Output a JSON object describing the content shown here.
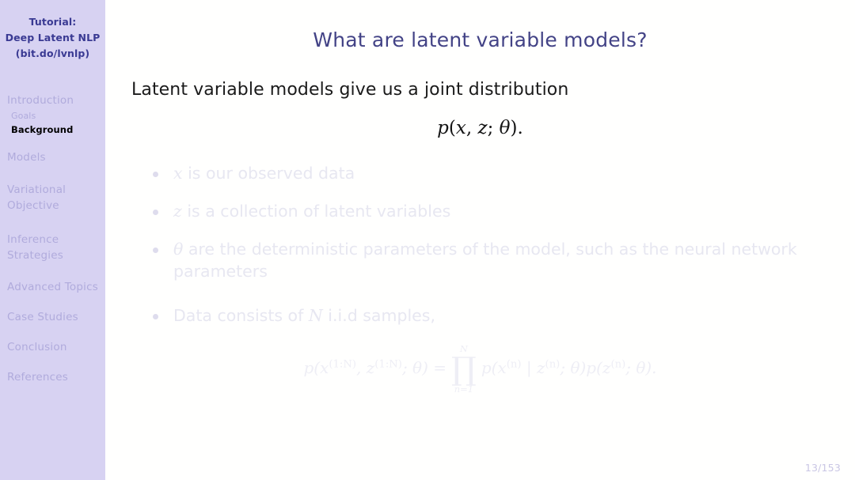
{
  "sidebar": {
    "title_lines": [
      "Tutorial:",
      "Deep Latent NLP",
      "(bit.do/lvnlp)"
    ],
    "nav": [
      {
        "label": "Introduction",
        "type": "section",
        "active": false
      },
      {
        "label": "Goals",
        "type": "subsection",
        "active": false
      },
      {
        "label": "Background",
        "type": "subsection",
        "active": true
      },
      {
        "label": "Models",
        "type": "section",
        "active": false
      },
      {
        "label": "Variational",
        "label2": "Objective",
        "type": "section",
        "active": false
      },
      {
        "label": "Inference",
        "label2": "Strategies",
        "type": "section",
        "active": false
      },
      {
        "label": "Advanced Topics",
        "type": "section",
        "active": false
      },
      {
        "label": "Case Studies",
        "type": "section",
        "active": false
      },
      {
        "label": "Conclusion",
        "type": "section",
        "active": false
      },
      {
        "label": "References",
        "type": "section",
        "active": false
      }
    ]
  },
  "main": {
    "title": "What are latent variable models?",
    "lead": "Latent variable models give us a joint distribution",
    "equation_joint": {
      "p": "p",
      "open": "(",
      "x": "x",
      "comma": ", ",
      "z": "z",
      "semi": "; ",
      "theta": "θ",
      "close": ").",
      "full_text": "p(x, z; θ)."
    },
    "bullets": [
      {
        "symbol": "x",
        "text": " is our observed data",
        "full_text": "x is our observed data"
      },
      {
        "symbol": "z",
        "text": " is a collection of latent variables",
        "full_text": "z is a collection of latent variables"
      },
      {
        "symbol": "θ",
        "text": " are the deterministic parameters of the model, such as the neural network parameters",
        "full_text": "θ are the deterministic parameters of the model, such as the neural network parameters"
      },
      {
        "symbol": "",
        "text_before": "Data consists of ",
        "symbol_mid": "N",
        "text_after": " i.i.d samples,",
        "full_text": "Data consists of N i.i.d samples,"
      }
    ],
    "equation_product": {
      "lhs": "p(x",
      "lhs_sup1": "(1:N)",
      "lhs_mid": ", z",
      "lhs_sup2": "(1:N)",
      "lhs_end": "; θ) =",
      "prod_upper": "N",
      "prod_symbol": "∏",
      "prod_lower": "n=1",
      "rhs_a": "p(x",
      "rhs_sup_a": "(n)",
      "rhs_bar": " | z",
      "rhs_sup_b": "(n)",
      "rhs_mid": "; θ)p(z",
      "rhs_sup_c": "(n)",
      "rhs_end": "; θ).",
      "full_text": "p(x^(1:N), z^(1:N); θ) = ∏_{n=1}^{N} p(x^(n) | z^(n); θ)p(z^(n); θ)."
    },
    "page_number": "13/153"
  },
  "colors": {
    "sidebar_bg": "#d7d2f2",
    "sidebar_title": "#3a3a93",
    "sidebar_nav": "#b0abdc",
    "sidebar_nav_active": "#000000",
    "slide_title": "#434386",
    "body_text": "#1a1a1a",
    "faded_text": "#e7e7f1",
    "page_number": "#c9c6e4"
  }
}
